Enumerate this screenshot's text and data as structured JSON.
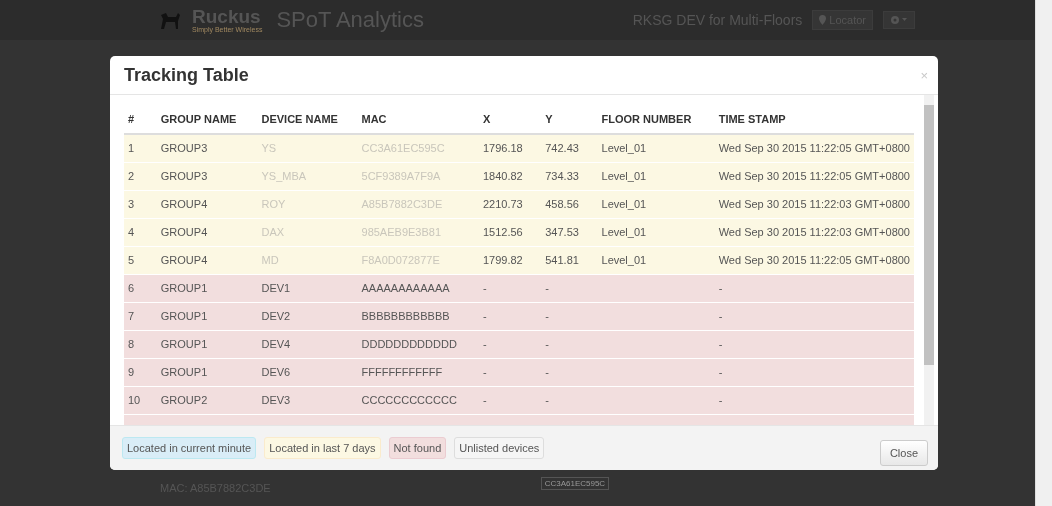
{
  "header": {
    "brand": "Ruckus",
    "tagline": "Simply Better Wireless",
    "app_title": "SPoT Analytics",
    "venue": "RKSG DEV for Multi-Floors",
    "locator_button": "Locator"
  },
  "background": {
    "mac_label": "MAC: A85B7882C3DE",
    "map_tag": "CC3A61EC595C"
  },
  "modal": {
    "title": "Tracking Table",
    "close_icon": "×",
    "columns": [
      "#",
      "GROUP NAME",
      "DEVICE NAME",
      "MAC",
      "X",
      "Y",
      "FLOOR NUMBER",
      "TIME STAMP"
    ],
    "rows": [
      {
        "kind": "last7",
        "cells": [
          "1",
          "GROUP3",
          "YS",
          "CC3A61EC595C",
          "1796.18",
          "742.43",
          "Level_01",
          "Wed Sep 30 2015 11:22:05 GMT+0800"
        ]
      },
      {
        "kind": "last7",
        "cells": [
          "2",
          "GROUP3",
          "YS_MBA",
          "5CF9389A7F9A",
          "1840.82",
          "734.33",
          "Level_01",
          "Wed Sep 30 2015 11:22:05 GMT+0800"
        ]
      },
      {
        "kind": "last7",
        "cells": [
          "3",
          "GROUP4",
          "ROY",
          "A85B7882C3DE",
          "2210.73",
          "458.56",
          "Level_01",
          "Wed Sep 30 2015 11:22:03 GMT+0800"
        ]
      },
      {
        "kind": "last7",
        "cells": [
          "4",
          "GROUP4",
          "DAX",
          "985AEB9E3B81",
          "1512.56",
          "347.53",
          "Level_01",
          "Wed Sep 30 2015 11:22:03 GMT+0800"
        ]
      },
      {
        "kind": "last7",
        "cells": [
          "5",
          "GROUP4",
          "MD",
          "F8A0D072877E",
          "1799.82",
          "541.81",
          "Level_01",
          "Wed Sep 30 2015 11:22:05 GMT+0800"
        ]
      },
      {
        "kind": "notfound",
        "cells": [
          "6",
          "GROUP1",
          "DEV1",
          "AAAAAAAAAAAA",
          "-",
          "-",
          "",
          "-"
        ]
      },
      {
        "kind": "notfound",
        "cells": [
          "7",
          "GROUP1",
          "DEV2",
          "BBBBBBBBBBBB",
          "-",
          "-",
          "",
          "-"
        ]
      },
      {
        "kind": "notfound",
        "cells": [
          "8",
          "GROUP1",
          "DEV4",
          "DDDDDDDDDDDD",
          "-",
          "-",
          "",
          "-"
        ]
      },
      {
        "kind": "notfound",
        "cells": [
          "9",
          "GROUP1",
          "DEV6",
          "FFFFFFFFFFFF",
          "-",
          "-",
          "",
          "-"
        ]
      },
      {
        "kind": "notfound",
        "cells": [
          "10",
          "GROUP2",
          "DEV3",
          "CCCCCCCCCCCC",
          "-",
          "-",
          "",
          "-"
        ]
      },
      {
        "kind": "notfound",
        "cells": [
          "",
          "",
          "",
          "",
          "",
          "",
          "",
          ""
        ]
      }
    ],
    "legend": [
      {
        "kind": "current",
        "label": "Located in current minute"
      },
      {
        "kind": "last7",
        "label": "Located in last 7 days"
      },
      {
        "kind": "notfound",
        "label": "Not found"
      },
      {
        "kind": "unlisted",
        "label": "Unlisted devices"
      }
    ],
    "close_button": "Close"
  }
}
